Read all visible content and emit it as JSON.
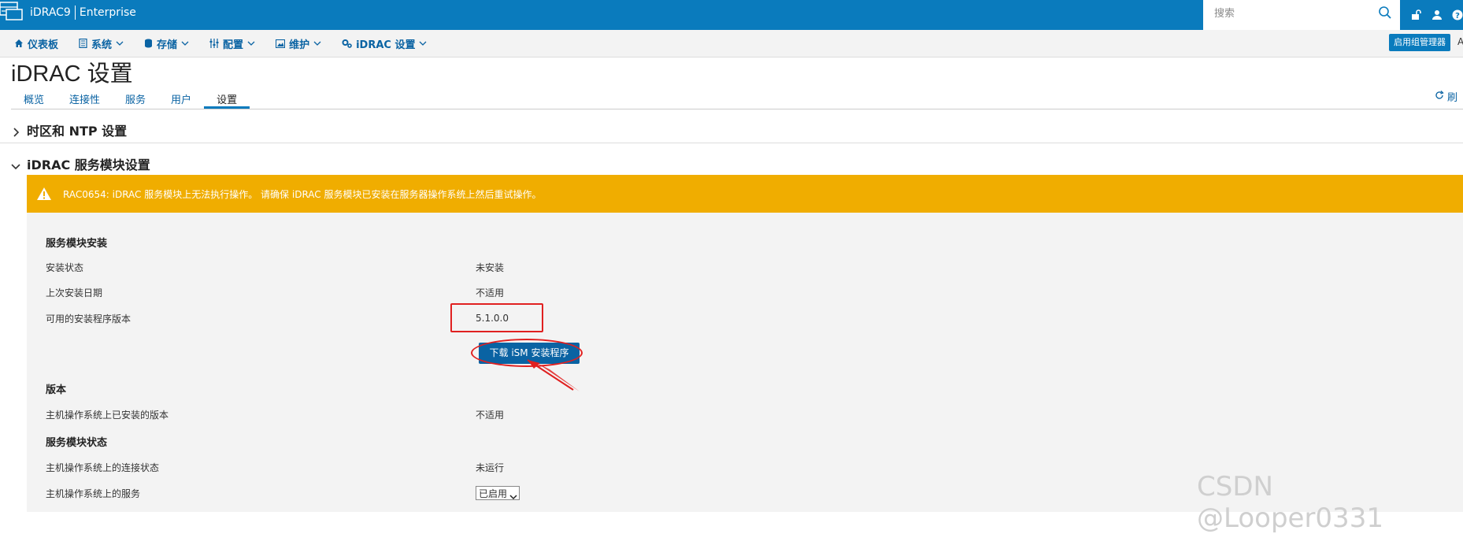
{
  "topbar": {
    "product": "iDRAC9",
    "edition": "Enterprise",
    "search_placeholder": "搜索"
  },
  "nav": {
    "items": [
      {
        "label": "仪表板"
      },
      {
        "label": "系统"
      },
      {
        "label": "存储"
      },
      {
        "label": "配置"
      },
      {
        "label": "维护"
      },
      {
        "label": "iDRAC 设置"
      }
    ],
    "group_manager": "启用组管理器",
    "more": "A"
  },
  "page": {
    "title": "iDRAC 设置",
    "tabs": [
      "概览",
      "连接性",
      "服务",
      "用户",
      "设置"
    ],
    "active_tab": "设置",
    "refresh_label": "刷"
  },
  "sections": {
    "timezone": "时区和 NTP 设置",
    "ism": "iDRAC 服务模块设置"
  },
  "alert": {
    "message": "RAC0654: iDRAC 服务模块上无法执行操作。 请确保 iDRAC 服务模块已安装在服务器操作系统上然后重试操作。",
    "color": "#f0ad00"
  },
  "install": {
    "header": "服务模块安装",
    "status_label": "安装状态",
    "status_value": "未安装",
    "last_date_label": "上次安装日期",
    "last_date_value": "不适用",
    "available_label": "可用的安装程序版本",
    "available_value": "5.1.0.0",
    "download_button": "下载 iSM 安装程序"
  },
  "version": {
    "header": "版本",
    "host_installed_label": "主机操作系统上已安装的版本",
    "host_installed_value": "不适用"
  },
  "status": {
    "header": "服务模块状态",
    "connection_label": "主机操作系统上的连接状态",
    "connection_value": "未运行",
    "service_label": "主机操作系统上的服务",
    "service_value": "已启用"
  },
  "watermark": "CSDN @Looper0331",
  "colors": {
    "brand": "#0a7bbd",
    "link": "#0a63a3",
    "annotation": "#e02020"
  }
}
